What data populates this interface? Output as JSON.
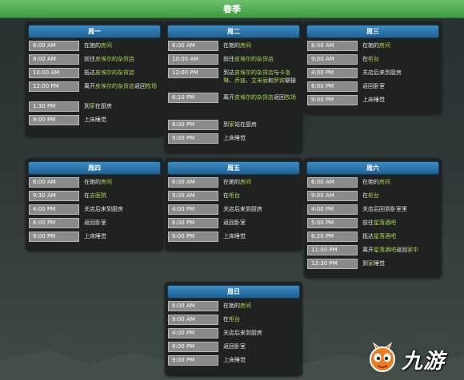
{
  "title": "春季",
  "days": [
    {
      "name": "周一",
      "rows": [
        {
          "time": "6:00 AM",
          "parts": [
            {
              "t": "在她的"
            },
            {
              "t": "房间",
              "hl": true
            }
          ]
        },
        {
          "time": "8:00 AM",
          "parts": [
            {
              "t": "前往"
            },
            {
              "t": "皮埃尔的杂货店",
              "hl": true
            }
          ]
        },
        {
          "time": "10:00 AM",
          "parts": [
            {
              "t": "抵达"
            },
            {
              "t": "皮埃尔的杂货店",
              "hl": true
            }
          ]
        },
        {
          "time": "12:00 PM",
          "parts": [
            {
              "t": "离开"
            },
            {
              "t": "皮埃尔的杂货店",
              "hl": true
            },
            {
              "t": "返回"
            },
            {
              "t": "牧场",
              "hl": true
            }
          ]
        },
        {
          "time": "1:30 PM",
          "parts": [
            {
              "t": "到"
            },
            {
              "t": "家",
              "hl": true
            },
            {
              "t": "在厨房"
            }
          ]
        },
        {
          "time": "9:00 PM",
          "parts": [
            {
              "t": "上床睡觉"
            }
          ]
        }
      ]
    },
    {
      "name": "周二",
      "rows": [
        {
          "time": "6:00 AM",
          "parts": [
            {
              "t": "在她的"
            },
            {
              "t": "房间",
              "hl": true
            }
          ]
        },
        {
          "time": "10:00 AM",
          "parts": [
            {
              "t": "前往"
            },
            {
              "t": "皮埃尔的杂货店",
              "hl": true
            }
          ]
        },
        {
          "time": "12:00 PM",
          "parts": [
            {
              "t": "到达"
            },
            {
              "t": "皮埃尔的杂货店",
              "hl": true
            },
            {
              "t": "与"
            },
            {
              "t": "卡洛琳",
              "hl": true
            },
            {
              "t": "、"
            },
            {
              "t": "乔迪",
              "hl": true
            },
            {
              "t": "、"
            },
            {
              "t": "艾米丽",
              "hl": true
            },
            {
              "t": "和"
            },
            {
              "t": "罗宾",
              "hl": true
            },
            {
              "t": "聊操"
            }
          ]
        },
        {
          "time": "6:10 PM",
          "parts": [
            {
              "t": "离开"
            },
            {
              "t": "皮埃尔的杂货店",
              "hl": true
            },
            {
              "t": "返回"
            },
            {
              "t": "牧场",
              "hl": true
            }
          ]
        },
        {
          "time": "8:00 PM",
          "parts": [
            {
              "t": "到"
            },
            {
              "t": "家",
              "hl": true
            },
            {
              "t": "站在厨房"
            }
          ]
        },
        {
          "time": "9:00 PM",
          "parts": [
            {
              "t": "上床睡觉"
            }
          ]
        }
      ]
    },
    {
      "name": "周三",
      "rows": [
        {
          "time": "6:00 AM",
          "parts": [
            {
              "t": "在她的"
            },
            {
              "t": "房间",
              "hl": true
            }
          ]
        },
        {
          "time": "9:00 AM",
          "parts": [
            {
              "t": "在"
            },
            {
              "t": "柜台",
              "hl": true
            }
          ]
        },
        {
          "time": "4:00 PM",
          "parts": [
            {
              "t": "关店后来到厨房"
            }
          ]
        },
        {
          "time": "6:00 PM",
          "parts": [
            {
              "t": "返回卧室"
            }
          ]
        },
        {
          "time": "9:00 PM",
          "parts": [
            {
              "t": "上床睡觉"
            }
          ]
        }
      ]
    },
    {
      "name": "周四",
      "rows": [
        {
          "time": "6:00 AM",
          "parts": [
            {
              "t": "在她的"
            },
            {
              "t": "房间",
              "hl": true
            }
          ]
        },
        {
          "time": "9:30 AM",
          "parts": [
            {
              "t": "在"
            },
            {
              "t": "去医院",
              "hl": true
            }
          ]
        },
        {
          "time": "4:00 PM",
          "parts": [
            {
              "t": "关店后来到厨房"
            }
          ]
        },
        {
          "time": "6:00 PM",
          "parts": [
            {
              "t": "返回卧室"
            }
          ]
        },
        {
          "time": "9:00 PM",
          "parts": [
            {
              "t": "上床睡觉"
            }
          ]
        }
      ]
    },
    {
      "name": "周五",
      "rows": [
        {
          "time": "6:00 AM",
          "parts": [
            {
              "t": "在她的"
            },
            {
              "t": "房间",
              "hl": true
            }
          ]
        },
        {
          "time": "9:00 AM",
          "parts": [
            {
              "t": "在"
            },
            {
              "t": "柜台",
              "hl": true
            }
          ]
        },
        {
          "time": "4:00 PM",
          "parts": [
            {
              "t": "关店后来到厨房"
            }
          ]
        },
        {
          "time": "6:00 PM",
          "parts": [
            {
              "t": "返回卧室"
            }
          ]
        },
        {
          "time": "9:00 PM",
          "parts": [
            {
              "t": "上床睡觉"
            }
          ]
        }
      ]
    },
    {
      "name": "周六",
      "rows": [
        {
          "time": "6:00 AM",
          "parts": [
            {
              "t": "在她的"
            },
            {
              "t": "房间",
              "hl": true
            }
          ]
        },
        {
          "time": "9:00 AM",
          "parts": [
            {
              "t": "在"
            },
            {
              "t": "柜台",
              "hl": true
            }
          ]
        },
        {
          "time": "4:00 PM",
          "parts": [
            {
              "t": "关店后回到卧室里"
            }
          ]
        },
        {
          "time": "5:00 PM",
          "parts": [
            {
              "t": "前往"
            },
            {
              "t": "星落酒吧",
              "hl": true
            }
          ]
        },
        {
          "time": "6:20 PM",
          "parts": [
            {
              "t": "抵达"
            },
            {
              "t": "星落酒吧",
              "hl": true
            }
          ]
        },
        {
          "time": "11:00 PM",
          "parts": [
            {
              "t": "离开"
            },
            {
              "t": "星落酒吧",
              "hl": true
            },
            {
              "t": "返回"
            },
            {
              "t": "家中",
              "hl": true
            }
          ]
        },
        {
          "time": "12:30 PM",
          "parts": [
            {
              "t": "到"
            },
            {
              "t": "家",
              "hl": true
            },
            {
              "t": "睡觉"
            }
          ]
        }
      ]
    },
    {
      "name": "周日",
      "rows": [
        {
          "time": "6:00 AM",
          "parts": [
            {
              "t": "在她的"
            },
            {
              "t": "房间",
              "hl": true
            }
          ]
        },
        {
          "time": "9:00 AM",
          "parts": [
            {
              "t": "在"
            },
            {
              "t": "柜台",
              "hl": true
            }
          ]
        },
        {
          "time": "4:00 PM",
          "parts": [
            {
              "t": "关店后来到厨房"
            }
          ]
        },
        {
          "time": "6:00 PM",
          "parts": [
            {
              "t": "返回卧室"
            }
          ]
        },
        {
          "time": "9:00 PM",
          "parts": [
            {
              "t": "上床睡觉"
            }
          ]
        }
      ]
    }
  ],
  "watermark": {
    "text": "九游",
    "icon": "mascot-icon"
  },
  "colors": {
    "header": "#4eaa4f",
    "day_header": "#2d74aa",
    "highlight": "#a8d84e",
    "card": "#202222",
    "time_cell": "#8a8a8a"
  }
}
